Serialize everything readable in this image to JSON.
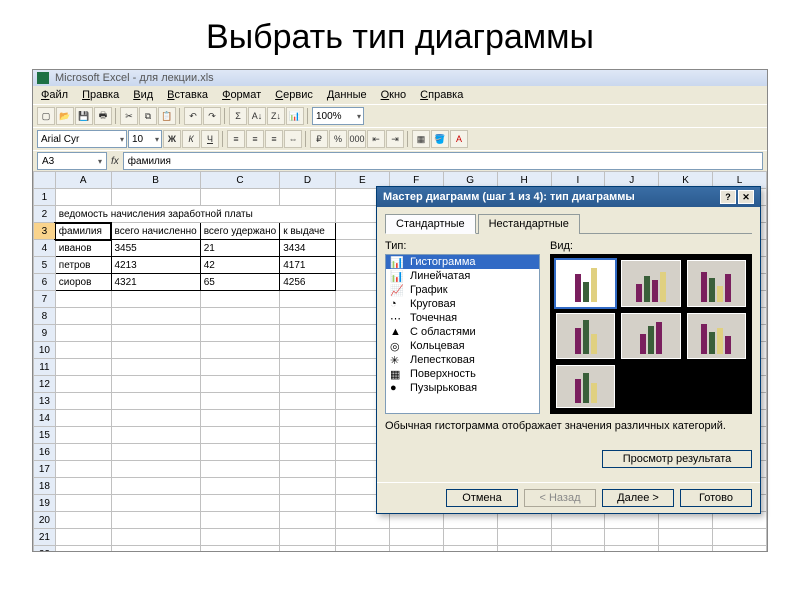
{
  "slide_title": "Выбрать тип диаграммы",
  "window_title": "Microsoft Excel - для лекции.xls",
  "menu": [
    "Файл",
    "Правка",
    "Вид",
    "Вставка",
    "Формат",
    "Сервис",
    "Данные",
    "Окно",
    "Справка"
  ],
  "font_name": "Arial Cyr",
  "font_size": "10",
  "zoom": "100%",
  "name_box": "A3",
  "formula_value": "фамилия",
  "columns": [
    "A",
    "B",
    "C",
    "D",
    "E",
    "F",
    "G",
    "H",
    "I",
    "J",
    "K",
    "L"
  ],
  "row_count": 24,
  "sheet": {
    "merged_title_row": 2,
    "merged_title": "ведомость начисления заработной платы",
    "header_row": 3,
    "headers": [
      "фамилия",
      "всего начисленно",
      "всего удержано",
      "к выдаче"
    ],
    "data_rows": [
      {
        "row": 4,
        "cells": [
          "иванов",
          "3455",
          "21",
          "3434"
        ]
      },
      {
        "row": 5,
        "cells": [
          "петров",
          "4213",
          "42",
          "4171"
        ]
      },
      {
        "row": 6,
        "cells": [
          "сиоров",
          "4321",
          "65",
          "4256"
        ]
      }
    ]
  },
  "dialog": {
    "title": "Мастер диаграмм (шаг 1 из 4): тип диаграммы",
    "tabs": [
      "Стандартные",
      "Нестандартные"
    ],
    "active_tab": 0,
    "type_label": "Тип:",
    "view_label": "Вид:",
    "types": [
      "Гистограмма",
      "Линейчатая",
      "График",
      "Круговая",
      "Точечная",
      "С областями",
      "Кольцевая",
      "Лепестковая",
      "Поверхность",
      "Пузырьковая"
    ],
    "selected_type": 0,
    "selected_view": 0,
    "view_count": 7,
    "description": "Обычная гистограмма отображает значения различных категорий.",
    "preview_btn": "Просмотр результата",
    "buttons": {
      "cancel": "Отмена",
      "back": "< Назад",
      "next": "Далее >",
      "finish": "Готово"
    }
  },
  "chart_data": {
    "type": "bar",
    "title": "ведомость начисления заработной платы",
    "categories": [
      "иванов",
      "петров",
      "сиоров"
    ],
    "series": [
      {
        "name": "всего начисленно",
        "values": [
          3455,
          4213,
          4321
        ]
      },
      {
        "name": "всего удержано",
        "values": [
          21,
          42,
          65
        ]
      },
      {
        "name": "к выдаче",
        "values": [
          3434,
          4171,
          4256
        ]
      }
    ],
    "xlabel": "фамилия",
    "ylabel": "",
    "ylim": [
      0,
      5000
    ]
  }
}
